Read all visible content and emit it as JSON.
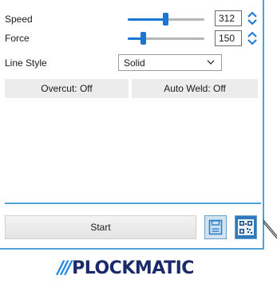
{
  "settings": {
    "speed": {
      "label": "Speed",
      "value": "312",
      "level": 0.5
    },
    "force": {
      "label": "Force",
      "value": "150",
      "level": 0.2
    },
    "line_style": {
      "label": "Line Style",
      "selected": "Solid"
    }
  },
  "toggles": {
    "overcut": "Overcut: Off",
    "auto_weld": "Auto Weld: Off"
  },
  "actions": {
    "start": "Start",
    "save_icon": "save-icon",
    "qr_icon": "qr-code-icon"
  },
  "brand": {
    "slashes": "///",
    "name": "PLOCKMATIC"
  },
  "colors": {
    "accent": "#1976d2",
    "border": "#4fa1d6",
    "logo": "#1b2a6b"
  }
}
